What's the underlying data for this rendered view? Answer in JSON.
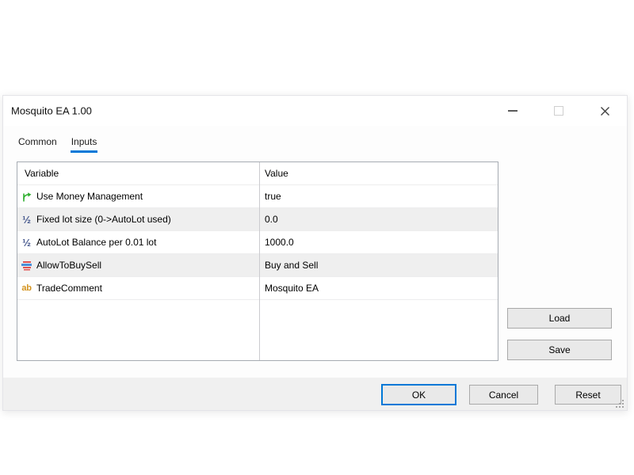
{
  "window": {
    "title": "Mosquito EA 1.00",
    "controls": [
      "minimize",
      "maximize",
      "close"
    ]
  },
  "tabs": [
    {
      "label": "Common",
      "active": false
    },
    {
      "label": "Inputs",
      "active": true
    }
  ],
  "table": {
    "columns": [
      "Variable",
      "Value"
    ],
    "rows": [
      {
        "icon": "bool",
        "variable": "Use Money Management",
        "value": "true",
        "highlighted": false
      },
      {
        "icon": "double",
        "variable": "Fixed lot size (0->AutoLot used)",
        "value": "0.0",
        "highlighted": true
      },
      {
        "icon": "double",
        "variable": "AutoLot Balance per 0.01 lot",
        "value": "1000.0",
        "highlighted": false
      },
      {
        "icon": "enum",
        "variable": "AllowToBuySell",
        "value": "Buy and Sell",
        "highlighted": true
      },
      {
        "icon": "string",
        "variable": "TradeComment",
        "value": "Mosquito EA",
        "highlighted": false
      }
    ]
  },
  "icons": {
    "bool": "branch-arrow-icon",
    "double": "½",
    "enum": "stacked-bars-icon",
    "string": "ab"
  },
  "side_buttons": {
    "load": "Load",
    "save": "Save"
  },
  "footer_buttons": {
    "ok": "OK",
    "cancel": "Cancel",
    "reset": "Reset"
  },
  "colors": {
    "accent_blue": "#0078d7",
    "row_highlight": "#efefef",
    "footer_bg": "#f0f0f0",
    "table_border": "#a6abb2",
    "bool_icon_green": "#2faf2f",
    "double_icon_navy": "#44568c",
    "string_icon_orange": "#d4941f",
    "enum_red": "#e05252",
    "enum_blue": "#4a90d9"
  }
}
